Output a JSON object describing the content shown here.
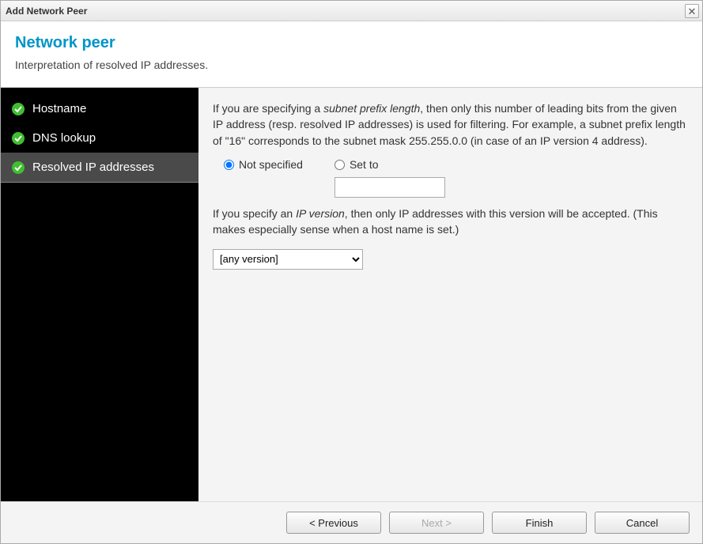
{
  "titlebar": {
    "title": "Add Network Peer"
  },
  "header": {
    "title": "Network peer",
    "subtitle": "Interpretation of resolved IP addresses."
  },
  "sidebar": {
    "items": [
      {
        "label": "Hostname",
        "done": true,
        "active": false
      },
      {
        "label": "DNS lookup",
        "done": true,
        "active": false
      },
      {
        "label": "Resolved IP addresses",
        "done": true,
        "active": true
      }
    ]
  },
  "content": {
    "para1_pre": "If you are specifying a ",
    "para1_em": "subnet prefix length",
    "para1_post": ", then only this number of leading bits from the given IP address (resp. resolved IP addresses) is used for filtering. For example, a subnet prefix length of \"16\" corresponds to the subnet mask 255.255.0.0 (in case of an IP version 4 address).",
    "radio_not_specified": "Not specified",
    "radio_set_to": "Set to",
    "prefix_value": "",
    "para2_pre": "If you specify an ",
    "para2_em": "IP version",
    "para2_post": ", then only IP addresses with this version will be accepted. (This makes especially sense when a host name is set.)",
    "ip_version_selected": "[any version]"
  },
  "footer": {
    "previous": "< Previous",
    "next": "Next >",
    "finish": "Finish",
    "cancel": "Cancel"
  }
}
